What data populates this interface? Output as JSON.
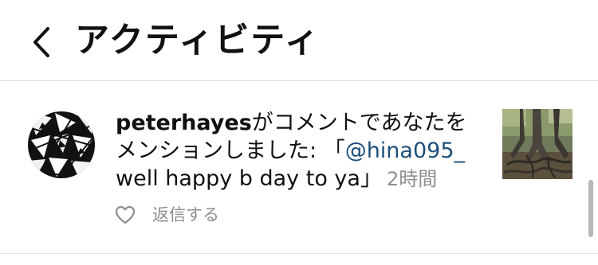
{
  "header": {
    "back_icon": "chevron-left-icon",
    "title": "アクティビティ"
  },
  "notification": {
    "avatar_icon": "user-avatar",
    "username": "peterhayes",
    "message_prefix": "がコメントであなたをメンションしました: 「",
    "mention": "@hina095_",
    "comment_body": " well happy b day to ya」",
    "timestamp": "2時間",
    "like_icon": "heart-outline-icon",
    "reply_label": "返信する",
    "post_thumbnail": "tree-roots-photo"
  },
  "colors": {
    "text": "#111111",
    "secondary": "#8e8e8e",
    "mention": "#1d4e7a",
    "divider": "#dbdbdb"
  }
}
